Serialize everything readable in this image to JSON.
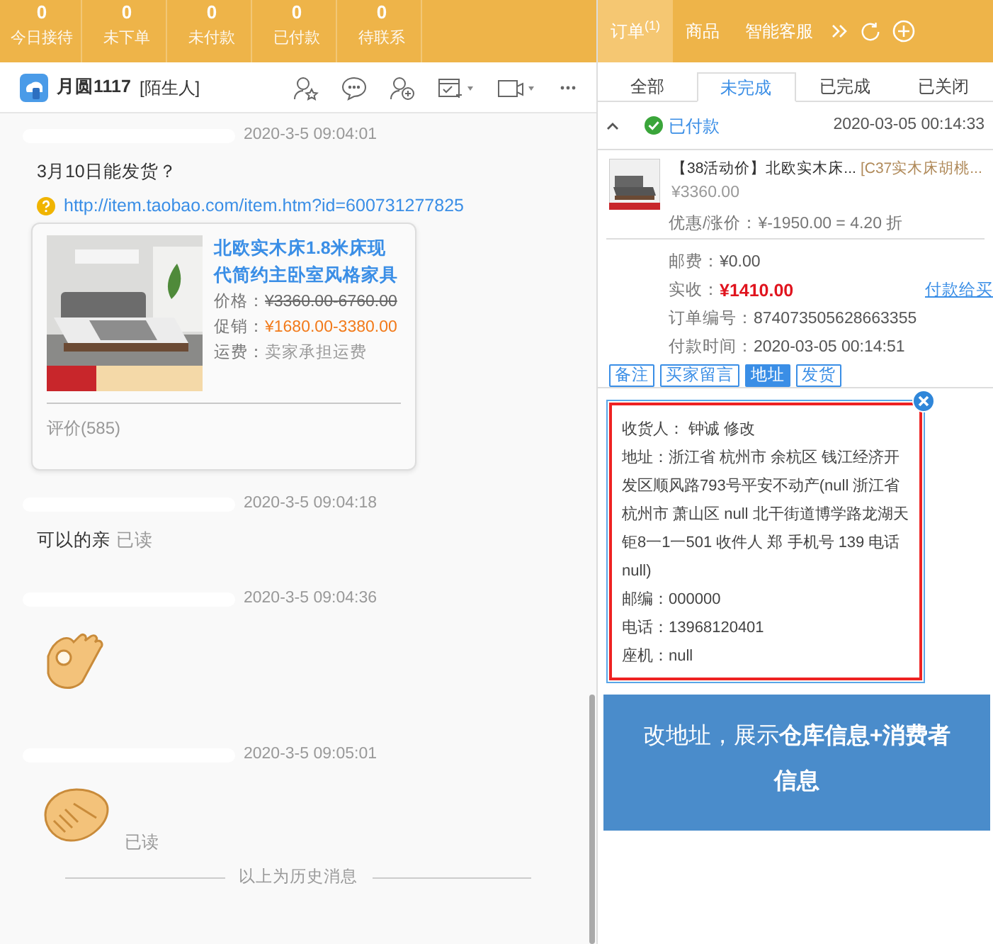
{
  "stats": [
    {
      "value": "0",
      "label": "今日接待"
    },
    {
      "value": "0",
      "label": "未下单"
    },
    {
      "value": "0",
      "label": "未付款"
    },
    {
      "value": "0",
      "label": "已付款"
    },
    {
      "value": "0",
      "label": "待联系"
    }
  ],
  "right_tabs": [
    {
      "label": "订单",
      "badge": "(1)",
      "selected": true
    },
    {
      "label": "商品",
      "selected": false
    },
    {
      "label": "智能客服",
      "selected": false
    }
  ],
  "chat": {
    "contact": "月圆1117",
    "tag": "[陌生人]",
    "messages": [
      {
        "kind": "product",
        "time": "2020-3-5 09:04:01",
        "text": "3月10日能发货？",
        "link": "http://item.taobao.com/item.htm?id=600731277825",
        "card": {
          "title": "北欧实木床1.8米床现代简约主卧室风格家具",
          "price_label": "价格：",
          "price": "¥3360.00-6760.00",
          "promo_label": "促销：",
          "promo": "¥1680.00-3380.00",
          "ship_label": "运费：",
          "ship": "卖家承担运费",
          "reviews": "评价(585)"
        }
      },
      {
        "kind": "text",
        "time": "2020-3-5 09:04:18",
        "text": "可以的亲",
        "read": "已读"
      },
      {
        "kind": "ok_sticker",
        "time": "2020-3-5 09:04:36"
      },
      {
        "kind": "handshake_sticker",
        "time": "2020-3-5 09:05:01",
        "read": "已读"
      }
    ],
    "history_note": "以上为历史消息"
  },
  "order_tabs": [
    {
      "label": "全部",
      "selected": false
    },
    {
      "label": "未完成",
      "selected": true
    },
    {
      "label": "已完成",
      "selected": false
    },
    {
      "label": "已关闭",
      "selected": false
    }
  ],
  "order": {
    "expanded": true,
    "status": "已付款",
    "time": "2020-03-05 00:14:33",
    "title": "【38活动价】北欧实木床...",
    "sku": "[C37实木床胡桃...",
    "price": "¥3360.00",
    "discount": "优惠/涨价：¥-1950.00 = 4.20 折",
    "fields": [
      {
        "label": "邮费：",
        "value": "¥0.00",
        "kind": "plain"
      },
      {
        "label": "实收：",
        "value": "¥1410.00",
        "kind": "amount"
      },
      {
        "label": "订单编号：",
        "value": "874073505628663355",
        "kind": "plain"
      },
      {
        "label": "付款时间：",
        "value": "2020-03-05 00:14:51",
        "kind": "plain"
      }
    ],
    "pay_link": "付款给买",
    "actions": [
      {
        "label": "备注",
        "selected": false
      },
      {
        "label": "买家留言",
        "selected": false
      },
      {
        "label": "地址",
        "selected": true
      },
      {
        "label": "发货",
        "selected": false
      }
    ],
    "address": [
      "收货人： 钟诚 修改",
      "地址：浙江省 杭州市 余杭区 钱江经济开发区顺风路793号平安不动产(null 浙江省杭州市 萧山区 null 北干街道博学路龙湖天钜8一1一501 收件人 郑 手机号 139 电话 null)",
      "邮编：000000",
      "电话：13968120401",
      "座机：null"
    ]
  },
  "callout": "改地址，展示**仓库信息+消费者信息**"
}
